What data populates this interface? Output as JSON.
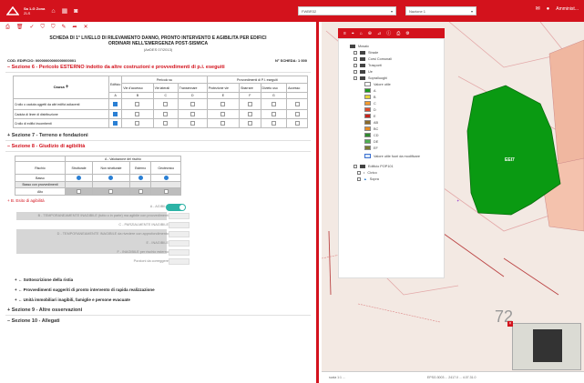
{
  "topbar": {
    "brand_line1": "Sa 1-G Zona",
    "brand_line2": "ZLS",
    "select1": "FWBR32",
    "select2": "Nazione 1",
    "user": "Amminist..."
  },
  "document": {
    "title_line1": "SCHEDA DI 1° LIVELLO DI RILEVAMENTO DANNO, PRONTO INTERVENTO E AGIBILITA PER EDIFICI",
    "title_line2": "ORDINARI NELL'EMERGENZA POST-SISMICA",
    "version": "(AeDES 07/2013)",
    "meta_left": "COD. EDIFICIO: 00000000000000000001",
    "meta_right": "N° SCHEDA: 1 000",
    "section6": "– Sezione 6 - Pericolo ESTERNO indotto da altre costruzioni e provvedimenti di p.i. eseguiti",
    "table6": {
      "col_cause": "Causa",
      "group1": "Pericolo su",
      "group2": "Provvedimenti di P.I. eseguiti",
      "h_edificio": "Edificio",
      "h_vie": "Vie d'accesso",
      "h_vie_laterali": "Vie laterali",
      "h_transennare": "Transennare",
      "h_protezione": "Protezione vie",
      "h_sbarrare": "Sbarrare",
      "h_divieto": "Divieto uso",
      "h_edificio2": "Edificio",
      "h_accesso": "Accesso",
      "row1": "Crollo o caduta oggetti da altri edifici adiacenti",
      "row2": "Caduta di linee di distribuzione",
      "row3": "Crollo di edifici incombenti",
      "sub_a": "A",
      "sub_b": "B",
      "sub_c": "C",
      "sub_d": "D",
      "sub_e": "E",
      "sub_f": "F",
      "sub_g": "G"
    },
    "section7": "+ Sezione 7 - Terreno e fondazioni",
    "section8": "– Sezione 8 - Giudizio di agibilità",
    "table8": {
      "caption": "A - Valutazione del rischio",
      "h_rischio": "Rischio",
      "h_1": "Strutturale",
      "h_2": "Non strutturale",
      "h_3": "Esterno",
      "h_4": "Geotecnico",
      "r_basso": "Basso",
      "r_basso_prov": "Basso con provvedimenti",
      "r_alto": "Alto"
    },
    "esito": "+ B. Esito di agibilità",
    "form": {
      "agibile": "A - AGIBILE",
      "l1": "B - TEMPORANEAMENTE INAGIBILE (tutto o in parte) ma agibile con provvedimenti",
      "l2": "C - PARZIALMENTE INAGIBILE",
      "l3": "D - TEMPORANEAMENTE INAGIBILE da rivedere con approfondimento",
      "l4": "E - INAGIBILE",
      "l5": "F - INAGIBILE per rischio esterno",
      "l6": "Porzioni da correggere"
    },
    "c1": "+ ← Sottoscrizione della ristia",
    "c2": "+ ← Provvedimenti suggeriti di pronto intervento di rapida realizzazione",
    "c3": "+ ← Unità immobiliari inagibili, famiglie e persone evacuate",
    "section9": "+ Sezione 9 - Altre osservazioni",
    "section10": "– Sezione 10 - Allegati"
  },
  "legend": {
    "root": "Mosaic",
    "items": [
      "Strade",
      "Corsi Comunali",
      "Trasporti",
      "Ue",
      "Sopralluoghi"
    ],
    "class_header": "Valore utile",
    "classes": [
      "A",
      "B",
      "C",
      "D",
      "E",
      "AB",
      "BC",
      "CD",
      "DE",
      "EF"
    ],
    "last": "Valore utile fuori da modificare",
    "base1": "Edificio POP101",
    "base2": "Civico",
    "base3": "Sopra"
  },
  "map": {
    "building_label": "EEI7",
    "parcel_label": "72",
    "scale": "scala 1:1  ...",
    "coords": "EPSG:3003 ... 2417.0 ... 4.07.31.0"
  },
  "colors": {
    "accent": "#d3121c",
    "building": "#0a9a12"
  }
}
